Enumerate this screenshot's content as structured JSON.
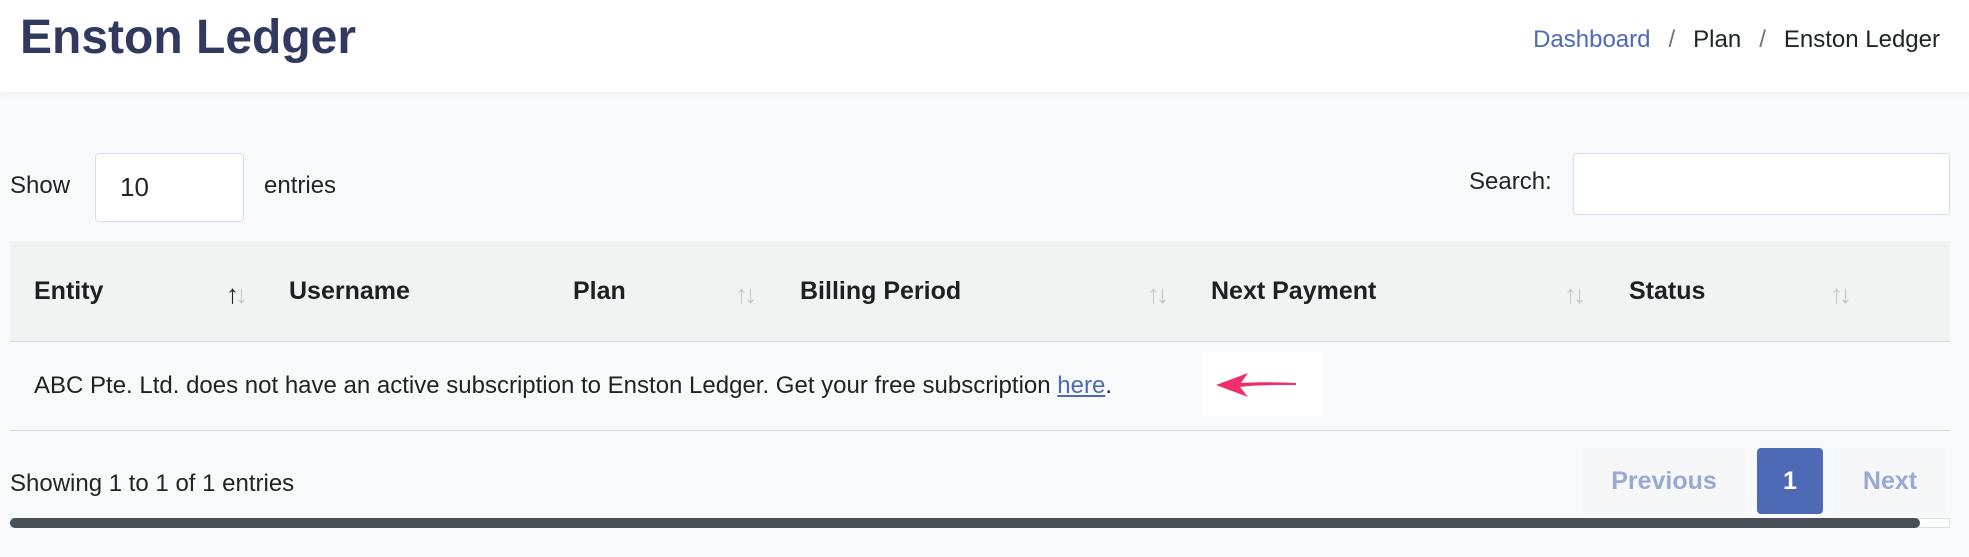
{
  "header": {
    "title": "Enston Ledger",
    "breadcrumb": [
      "Dashboard",
      "Plan",
      "Enston Ledger"
    ],
    "separator": "/"
  },
  "controls": {
    "show_label": "Show",
    "entries_value": "10",
    "entries_label": "entries",
    "search_label": "Search:",
    "search_value": ""
  },
  "table": {
    "columns": [
      "Entity",
      "Username",
      "Plan",
      "Billing Period",
      "Next Payment",
      "Status"
    ],
    "empty_message": "ABC Pte. Ltd. does not have an active subscription to Enston Ledger. Get your free subscription ",
    "empty_link": "here",
    "empty_suffix": "."
  },
  "footer": {
    "info": "Showing 1 to 1 of 1 entries",
    "previous": "Previous",
    "current_page": "1",
    "next": "Next"
  },
  "icons": {
    "sort": "sort-arrows-icon",
    "annotation": "pointer-arrow-icon"
  },
  "colors": {
    "title": "#313a5e",
    "link": "#4e69b5",
    "arrow": "#ee2f6b"
  }
}
